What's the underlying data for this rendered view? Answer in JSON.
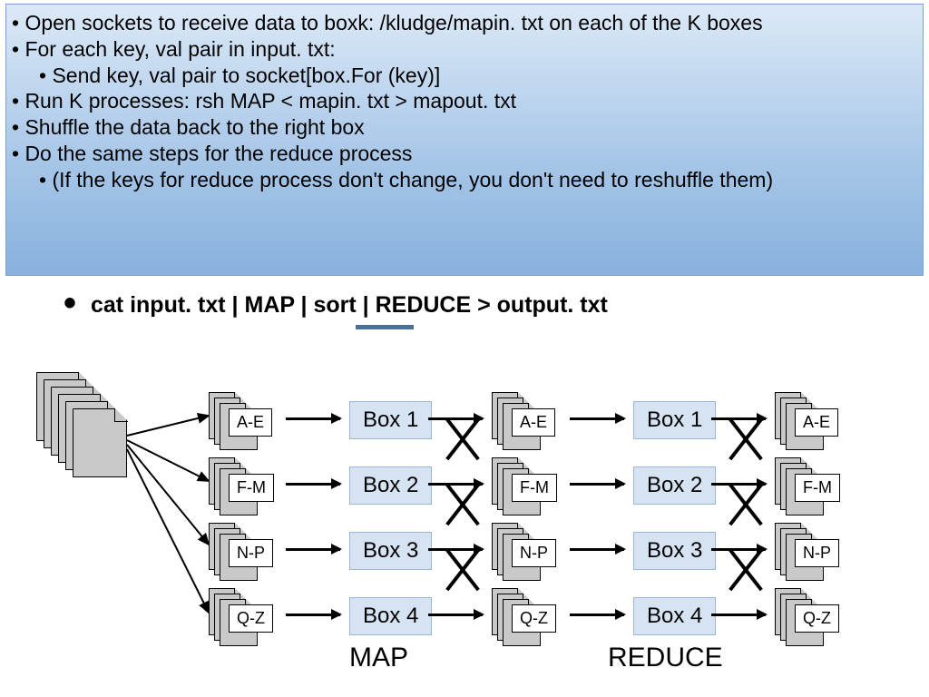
{
  "bullets": {
    "b1": "• Open sockets to receive data to boxk: /kludge/mapin. txt on each of the K boxes",
    "b2": "• For each key, val pair in input. txt:",
    "b3": "• Send key, val pair to socket[box.For (key)]",
    "b4": "• Run K processes: rsh MAP < mapin. txt > mapout. txt",
    "b5": "• Shuffle the data back to the right box",
    "b6": "• Do the same steps for the reduce process",
    "b7": "• (If the keys for reduce process don't change, you don't need to reshuffle them)"
  },
  "command": "cat input. txt | MAP | sort | REDUCE > output. txt",
  "ranges": [
    "A-E",
    "F-M",
    "N-P",
    "Q-Z"
  ],
  "boxes": [
    "Box 1",
    "Box 2",
    "Box 3",
    "Box 4"
  ],
  "phase": {
    "map": "MAP",
    "reduce": "REDUCE"
  }
}
